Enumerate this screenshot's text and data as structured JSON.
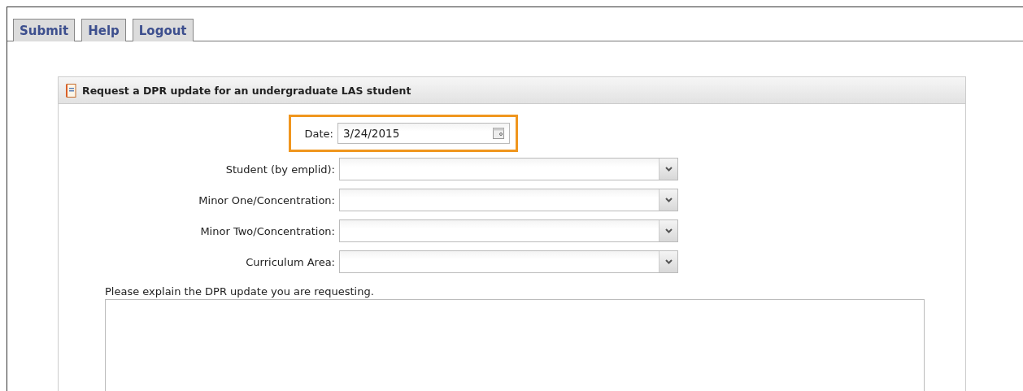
{
  "tabs": [
    {
      "label": "Submit"
    },
    {
      "label": "Help"
    },
    {
      "label": "Logout"
    }
  ],
  "panel": {
    "title": "Request a DPR update for an undergraduate LAS student",
    "fields": [
      {
        "kind": "date",
        "label": "Date:",
        "value": "3/24/2015",
        "highlighted": true
      },
      {
        "kind": "select",
        "label": "Student (by emplid):"
      },
      {
        "kind": "select",
        "label": "Minor One/Concentration:"
      },
      {
        "kind": "select",
        "label": "Minor Two/Concentration:"
      },
      {
        "kind": "select",
        "label": "Curriculum Area:"
      }
    ],
    "explain_label": "Please explain the DPR update you are requesting."
  }
}
